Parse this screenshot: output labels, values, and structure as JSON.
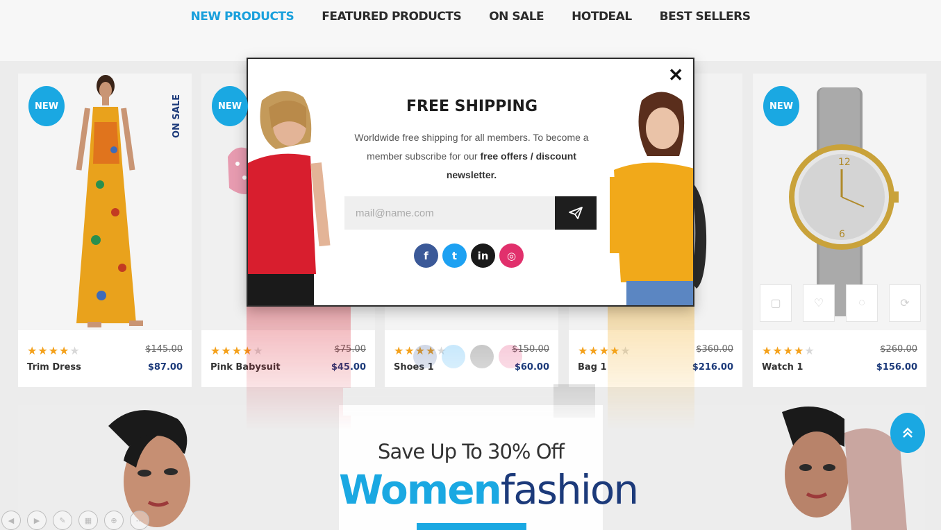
{
  "tabs": [
    {
      "label": "NEW PRODUCTS",
      "active": true
    },
    {
      "label": "FEATURED PRODUCTS",
      "active": false
    },
    {
      "label": "ON SALE",
      "active": false
    },
    {
      "label": "HOTDEAL",
      "active": false
    },
    {
      "label": "BEST SELLERS",
      "active": false
    }
  ],
  "products": [
    {
      "name": "Trim Dress",
      "old_price": "$145.00",
      "price": "$87.00",
      "badge": "NEW",
      "sale_badge": "ON SALE",
      "rating": 4
    },
    {
      "name": "Pink Babysuit",
      "old_price": "$75.00",
      "price": "$45.00",
      "badge": "NEW",
      "rating": 4
    },
    {
      "name": "Shoes 1",
      "old_price": "$150.00",
      "price": "$60.00",
      "rating": 4
    },
    {
      "name": "Bag 1",
      "old_price": "$360.00",
      "price": "$216.00",
      "rating": 4
    },
    {
      "name": "Watch 1",
      "old_price": "$260.00",
      "price": "$156.00",
      "badge": "NEW",
      "rating": 4
    }
  ],
  "popup": {
    "title": "FREE SHIPPING",
    "text_part1": "Worldwide free shipping for all members. To become a member subscribe for our ",
    "text_bold": "free offers / discount newsletter.",
    "email_placeholder": "mail@name.com",
    "close_symbol": "✕",
    "social": [
      {
        "name": "facebook",
        "glyph": "f"
      },
      {
        "name": "twitter",
        "glyph": "t"
      },
      {
        "name": "linkedin",
        "glyph": "in"
      },
      {
        "name": "instagram",
        "glyph": "◎"
      }
    ]
  },
  "banner": {
    "subtitle": "Save Up To 30% Off",
    "title_highlight": "Women",
    "title_rest": "fashion"
  },
  "colors": {
    "accent": "#1aa8e2",
    "navy": "#1c3a7a",
    "star": "#f4a11b"
  },
  "icons": {
    "scroll_top": "double-chevron-up-icon",
    "send": "paper-plane-icon"
  }
}
